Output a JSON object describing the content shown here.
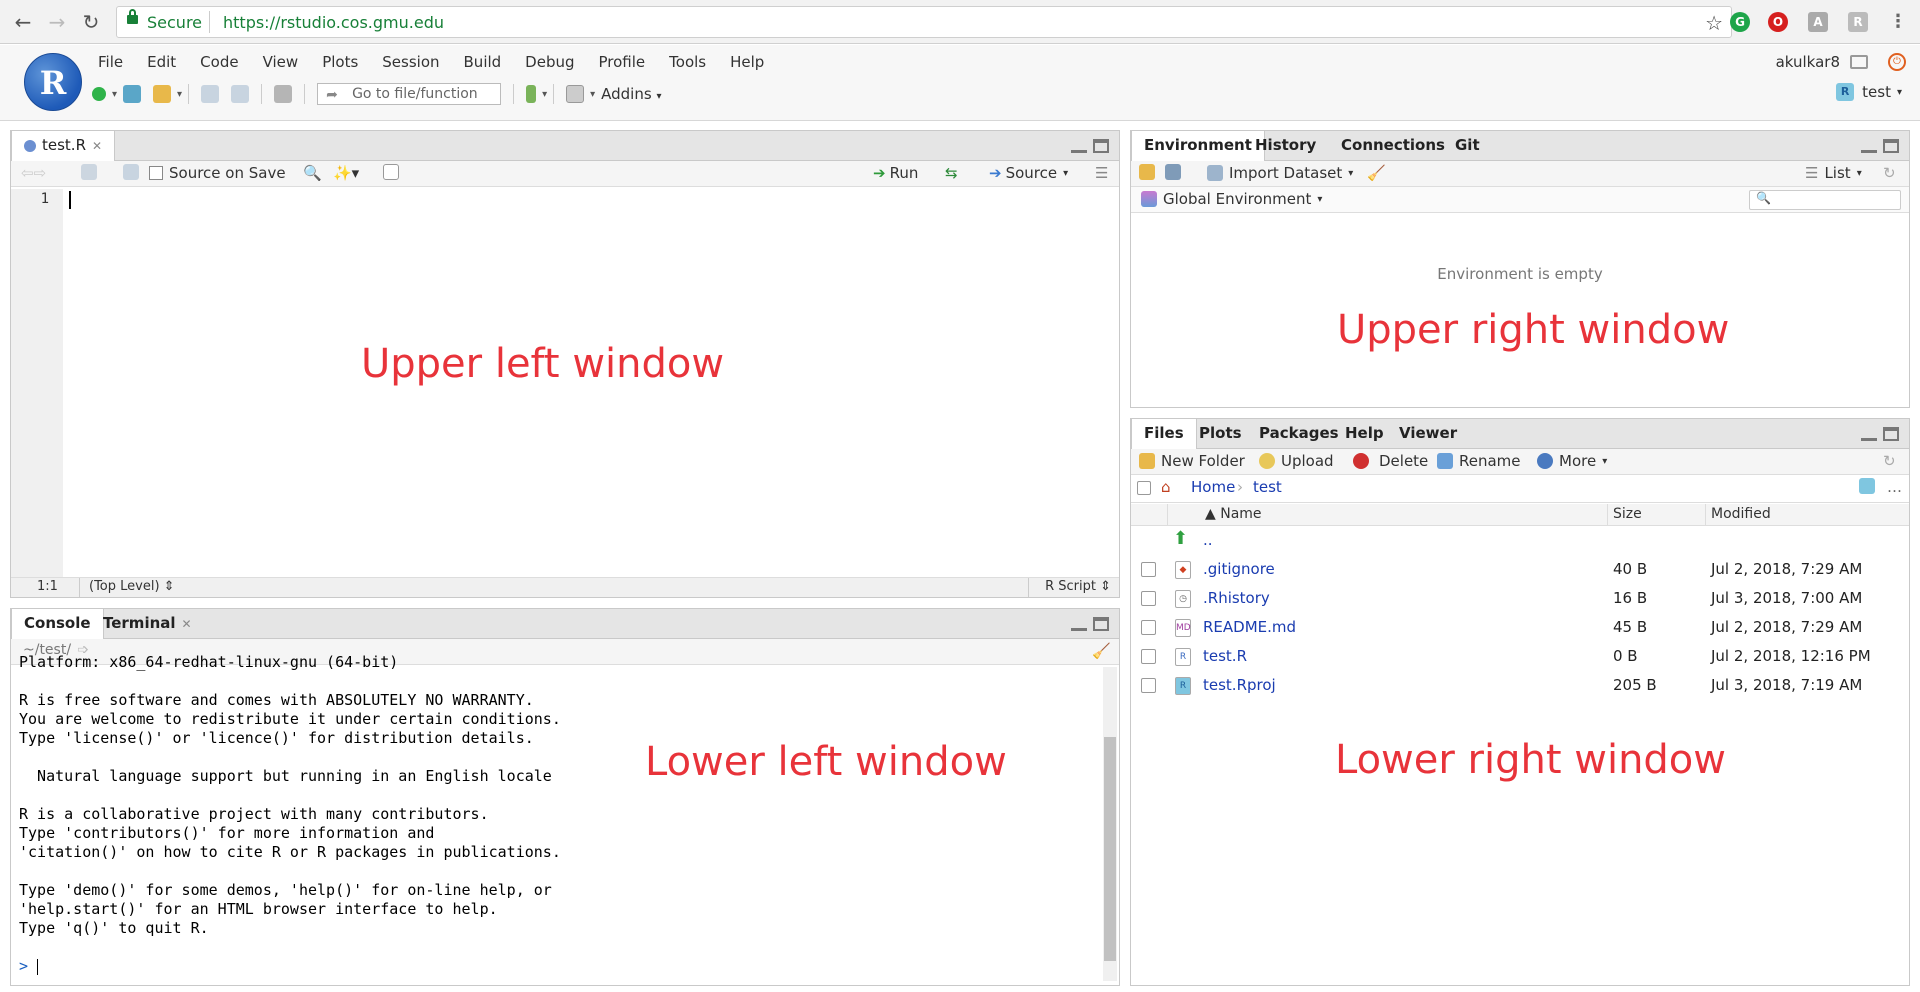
{
  "browser": {
    "secure_label": "Secure",
    "url_host": "https://rstudio.cos.gmu.edu",
    "url_path": ""
  },
  "menu": [
    "File",
    "Edit",
    "Code",
    "View",
    "Plots",
    "Session",
    "Build",
    "Debug",
    "Profile",
    "Tools",
    "Help"
  ],
  "header": {
    "logo_letter": "R",
    "user": "akulkar8",
    "goto_placeholder": "Go to file/function",
    "addins": "Addins",
    "project": "test"
  },
  "editor": {
    "tab": "test.R",
    "source_on_save": "Source on Save",
    "run": "Run",
    "source": "Source",
    "line_number": "1",
    "status_pos": "1:1",
    "status_level": "(Top Level)",
    "status_type": "R Script",
    "overlay_label": "Upper left window"
  },
  "console": {
    "tabs": [
      "Console",
      "Terminal"
    ],
    "path": "~/test/",
    "lines": [
      "Platform: x86_64-redhat-linux-gnu (64-bit)",
      "",
      "R is free software and comes with ABSOLUTELY NO WARRANTY.",
      "You are welcome to redistribute it under certain conditions.",
      "Type 'license()' or 'licence()' for distribution details.",
      "",
      "  Natural language support but running in an English locale",
      "",
      "R is a collaborative project with many contributors.",
      "Type 'contributors()' for more information and",
      "'citation()' on how to cite R or R packages in publications.",
      "",
      "Type 'demo()' for some demos, 'help()' for on-line help, or",
      "'help.start()' for an HTML browser interface to help.",
      "Type 'q()' to quit R."
    ],
    "prompt": ">",
    "overlay_label": "Lower left window"
  },
  "environment": {
    "tabs": [
      "Environment",
      "History",
      "Connections",
      "Git"
    ],
    "import_dataset": "Import Dataset",
    "list": "List",
    "global_env": "Global Environment",
    "empty_msg": "Environment is empty",
    "overlay_label": "Upper right window"
  },
  "files": {
    "tabs": [
      "Files",
      "Plots",
      "Packages",
      "Help",
      "Viewer"
    ],
    "actions": [
      "New Folder",
      "Upload",
      "Delete",
      "Rename",
      "More"
    ],
    "breadcrumb": [
      "Home",
      "test"
    ],
    "headers": {
      "name": "Name",
      "size": "Size",
      "modified": "Modified"
    },
    "up": "..",
    "rows": [
      {
        "name": ".gitignore",
        "size": "40 B",
        "modified": "Jul 2, 2018, 7:29 AM"
      },
      {
        "name": ".Rhistory",
        "size": "16 B",
        "modified": "Jul 3, 2018, 7:00 AM"
      },
      {
        "name": "README.md",
        "size": "45 B",
        "modified": "Jul 2, 2018, 7:29 AM"
      },
      {
        "name": "test.R",
        "size": "0 B",
        "modified": "Jul 2, 2018, 12:16 PM"
      },
      {
        "name": "test.Rproj",
        "size": "205 B",
        "modified": "Jul 3, 2018, 7:19 AM"
      }
    ],
    "overlay_label": "Lower right window"
  }
}
